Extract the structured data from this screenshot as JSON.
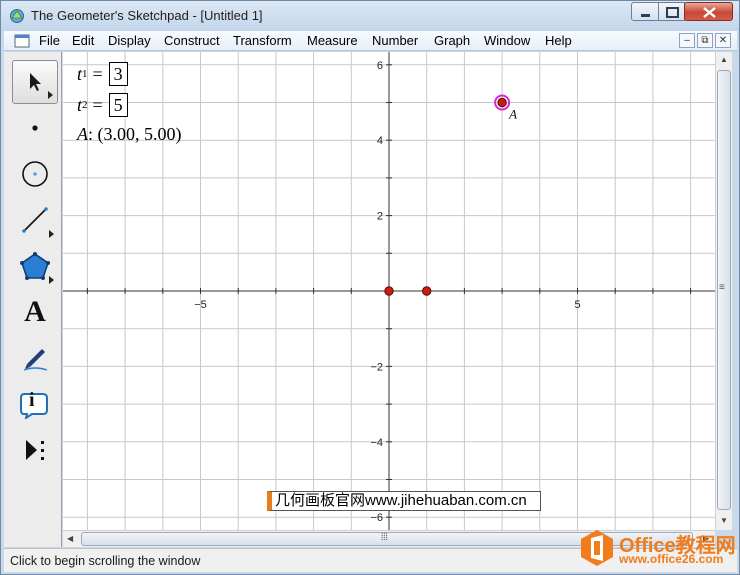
{
  "window": {
    "title": "The Geometer's Sketchpad - [Untitled 1]",
    "min_glyph": "▁",
    "max_glyph": "☐",
    "close_glyph": "✕"
  },
  "menu": [
    "File",
    "Edit",
    "Display",
    "Construct",
    "Transform",
    "Measure",
    "Number",
    "Graph",
    "Window",
    "Help"
  ],
  "mdi_controls": {
    "minimize": "–",
    "restore": "⧉",
    "close": "✕"
  },
  "toolbox": [
    {
      "name": "arrow-tool",
      "icon": "arrow-pointer-icon",
      "selected": true
    },
    {
      "name": "point-tool",
      "icon": "dot-icon"
    },
    {
      "name": "compass-tool",
      "icon": "circle-icon"
    },
    {
      "name": "straightedge-tool",
      "icon": "line-segment-icon"
    },
    {
      "name": "polygon-tool",
      "icon": "pentagon-icon"
    },
    {
      "name": "text-tool",
      "icon": "letter-a-icon",
      "label": "A"
    },
    {
      "name": "marker-tool",
      "icon": "pen-icon"
    },
    {
      "name": "information-tool",
      "icon": "info-icon",
      "label": "i"
    },
    {
      "name": "custom-tool",
      "icon": "play-dots-icon"
    }
  ],
  "parameters": [
    {
      "symbol": "t",
      "subscript": "1",
      "value": "3"
    },
    {
      "symbol": "t",
      "subscript": "2",
      "value": "5"
    }
  ],
  "measurement": {
    "label": "A",
    "text": ": (3.00, 5.00)"
  },
  "graph": {
    "x_ticks": [
      "−5",
      "5"
    ],
    "y_ticks": [
      "6",
      "4",
      "2",
      "−2",
      "−4",
      "−6"
    ],
    "points": [
      {
        "label": "",
        "x": 0,
        "y": 0,
        "color": "#cc1b12"
      },
      {
        "label": "",
        "x": 1,
        "y": 0,
        "color": "#cc1b12"
      },
      {
        "label": "A",
        "x": 3,
        "y": 5,
        "color": "#cc1b12",
        "selected": true
      }
    ]
  },
  "watermark": "几何画板官网www.jihehuaban.com.cn",
  "status": "Click to begin scrolling the window",
  "logo": {
    "title": "Office教程网",
    "url": "www.office26.com"
  }
}
